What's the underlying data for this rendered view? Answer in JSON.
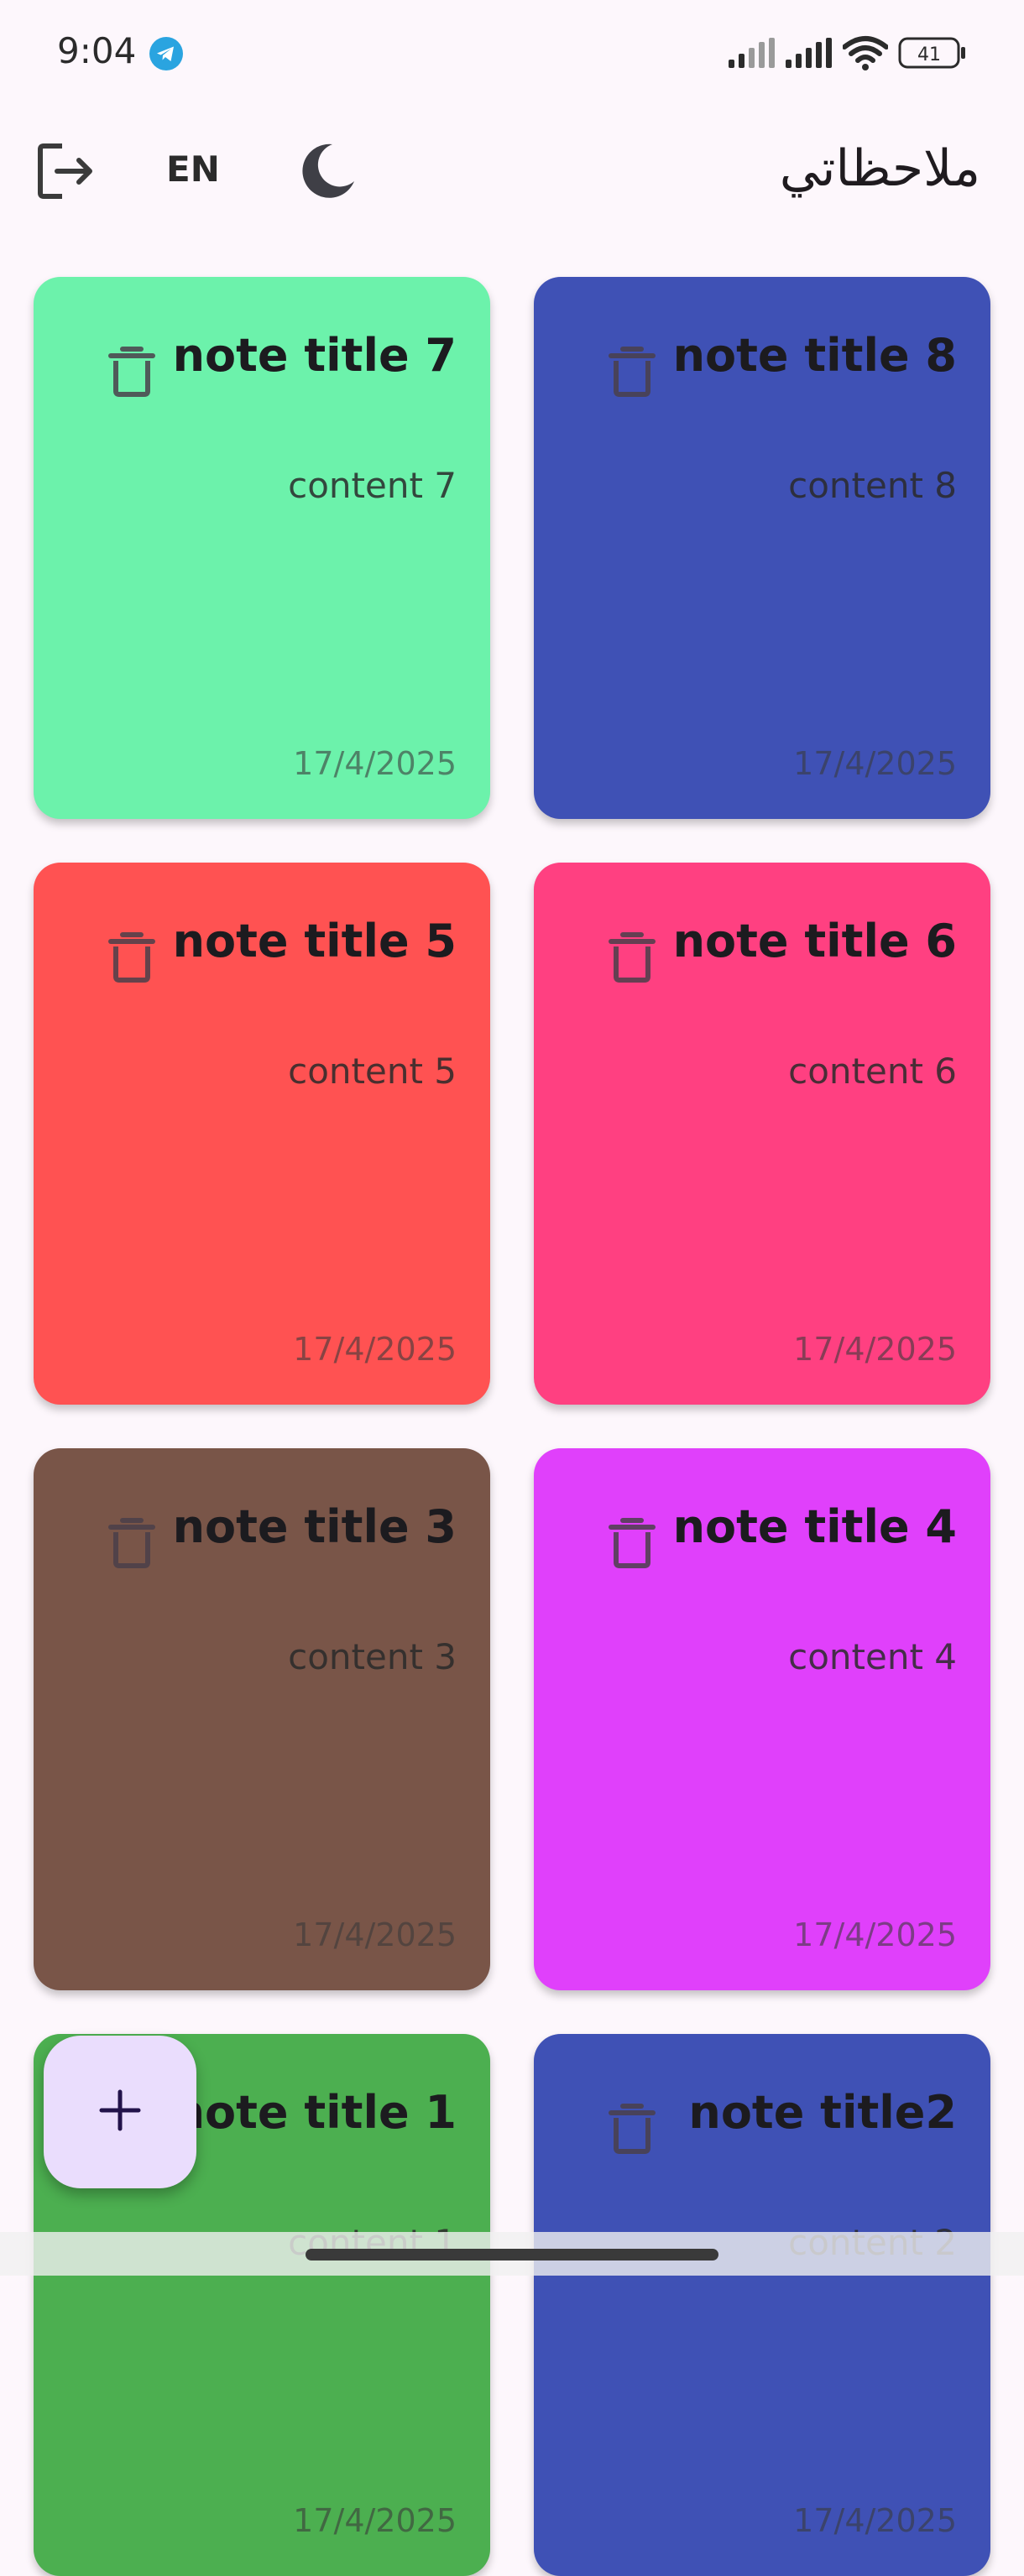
{
  "status_bar": {
    "time": "9:04",
    "battery": "41",
    "icons": [
      "telegram-icon",
      "signal-icon",
      "signal-icon",
      "wifi-icon",
      "battery-icon"
    ]
  },
  "app_bar": {
    "title": "ملاحظاتي",
    "language_label": "EN",
    "icons": [
      "logout-icon",
      "moon-icon"
    ]
  },
  "notes": [
    {
      "title": "note title 7",
      "content": "content 7",
      "date": "17/4/2025",
      "color": "#6cf2ab"
    },
    {
      "title": "note title 8",
      "content": "content 8",
      "date": "17/4/2025",
      "color": "#3f51b5"
    },
    {
      "title": "note title 5",
      "content": "content 5",
      "date": "17/4/2025",
      "color": "#ff5252"
    },
    {
      "title": "note title 6",
      "content": "content 6",
      "date": "17/4/2025",
      "color": "#ff4081"
    },
    {
      "title": "note title 3",
      "content": "content 3",
      "date": "17/4/2025",
      "color": "#795548"
    },
    {
      "title": "note title 4",
      "content": "content 4",
      "date": "17/4/2025",
      "color": "#e040fb"
    },
    {
      "title": "note title 1",
      "content": "content 1",
      "date": "17/4/2025",
      "color": "#4caf50"
    },
    {
      "title": "note title2",
      "content": "content 2",
      "date": "17/4/2025",
      "color": "#3f51b5"
    }
  ],
  "fab": {
    "icon": "plus-icon"
  }
}
